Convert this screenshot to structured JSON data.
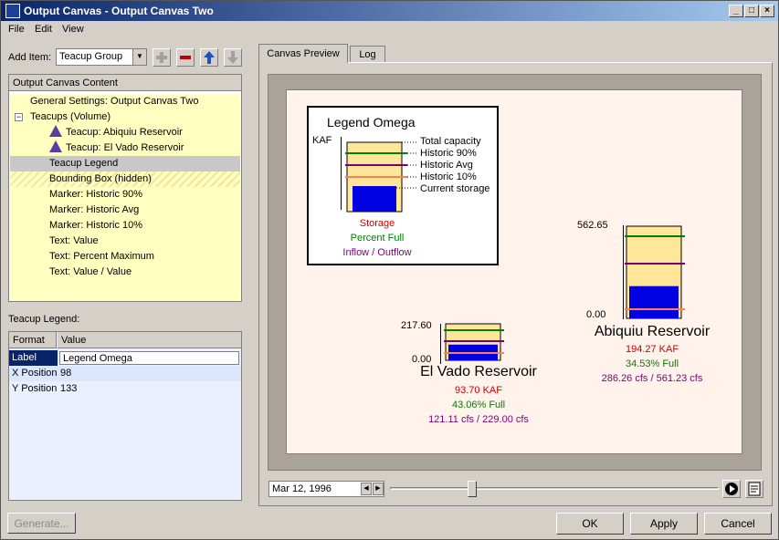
{
  "window": {
    "title": "Output Canvas - Output Canvas Two",
    "minimize_glyph": "_",
    "maximize_glyph": "□",
    "close_glyph": "×"
  },
  "menu": [
    "File",
    "Edit",
    "View"
  ],
  "add_item": {
    "label": "Add Item:",
    "selected": "Teacup Group"
  },
  "icons": [
    "add-icon",
    "remove-icon",
    "move-up-icon",
    "move-down-icon"
  ],
  "tree": {
    "header": "Output Canvas Content",
    "items": [
      "General Settings: Output Canvas Two",
      "Teacups (Volume)",
      "Teacup: Abiquiu Reservoir",
      "Teacup: El Vado Reservoir",
      "Teacup Legend",
      "Bounding Box (hidden)",
      "Marker: Historic 90%",
      "Marker: Historic Avg",
      "Marker: Historic 10%",
      "Text: Value",
      "Text: Percent Maximum",
      "Text: Value / Value"
    ],
    "expander": "−"
  },
  "properties": {
    "title": "Teacup Legend:",
    "col_format": "Format",
    "col_value": "Value",
    "rows": [
      {
        "format": "Label",
        "value": "Legend Omega"
      },
      {
        "format": "X Position",
        "value": "98"
      },
      {
        "format": "Y Position",
        "value": "133"
      }
    ]
  },
  "buttons": {
    "generate": "Generate...",
    "ok": "OK",
    "apply": "Apply",
    "cancel": "Cancel"
  },
  "tabs": [
    "Canvas Preview",
    "Log"
  ],
  "legend": {
    "title": "Legend Omega",
    "unit": "KAF",
    "items": [
      "Total capacity",
      "Historic 90%",
      "Historic Avg",
      "Historic 10%",
      "Current storage"
    ],
    "storage": "Storage",
    "percent": "Percent Full",
    "flow": "Inflow / Outflow"
  },
  "teacups": [
    {
      "name": "Abiquiu Reservoir",
      "max_label": "562.65",
      "min_label": "0.00",
      "storage": "194.27 KAF",
      "percent": "34.53% Full",
      "flow": "286.26 cfs / 561.23 cfs",
      "fill_fraction": 0.35
    },
    {
      "name": "El Vado Reservoir",
      "max_label": "217.60",
      "min_label": "0.00",
      "storage": "93.70 KAF",
      "percent": "43.06% Full",
      "flow": "121.11 cfs / 229.00 cfs",
      "fill_fraction": 0.43
    }
  ],
  "timeline": {
    "date": "Mar 12, 1996",
    "position": 0.25
  },
  "colors": {
    "storage_text": "#d00000",
    "percent_text": "#008000",
    "flow_text": "#7a007a",
    "cup_fill": "#ffe699",
    "current_storage": "#0000e0",
    "historic_90": "#008000",
    "historic_avg": "#7a007a",
    "historic_10": "#ff7f50"
  }
}
